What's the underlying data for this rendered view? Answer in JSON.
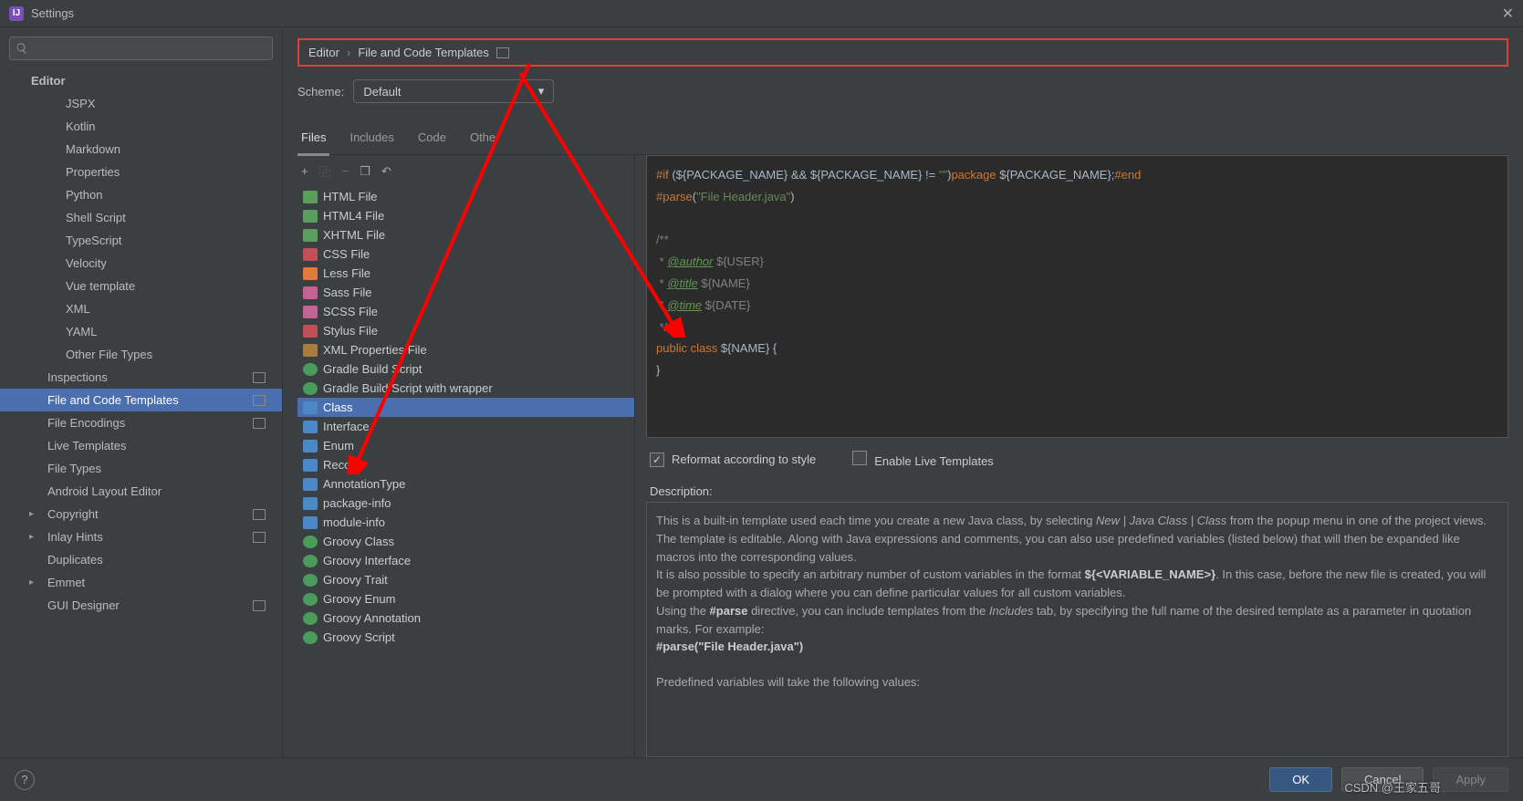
{
  "window": {
    "title": "Settings"
  },
  "sidebar": {
    "items": [
      {
        "label": "Editor",
        "lvl": 1
      },
      {
        "label": "JSPX",
        "lvl": 3
      },
      {
        "label": "Kotlin",
        "lvl": 3
      },
      {
        "label": "Markdown",
        "lvl": 3
      },
      {
        "label": "Properties",
        "lvl": 3
      },
      {
        "label": "Python",
        "lvl": 3
      },
      {
        "label": "Shell Script",
        "lvl": 3
      },
      {
        "label": "TypeScript",
        "lvl": 3
      },
      {
        "label": "Velocity",
        "lvl": 3
      },
      {
        "label": "Vue template",
        "lvl": 3
      },
      {
        "label": "XML",
        "lvl": 3
      },
      {
        "label": "YAML",
        "lvl": 3
      },
      {
        "label": "Other File Types",
        "lvl": 3
      },
      {
        "label": "Inspections",
        "lvl": 2,
        "badge": true
      },
      {
        "label": "File and Code Templates",
        "lvl": 2,
        "selected": true,
        "badge": true
      },
      {
        "label": "File Encodings",
        "lvl": 2,
        "badge": true
      },
      {
        "label": "Live Templates",
        "lvl": 2
      },
      {
        "label": "File Types",
        "lvl": 2
      },
      {
        "label": "Android Layout Editor",
        "lvl": 2
      },
      {
        "label": "Copyright",
        "lvl": 2,
        "expand": true,
        "badge": true
      },
      {
        "label": "Inlay Hints",
        "lvl": 2,
        "expand": true,
        "badge": true
      },
      {
        "label": "Duplicates",
        "lvl": 2
      },
      {
        "label": "Emmet",
        "lvl": 2,
        "expand": true
      },
      {
        "label": "GUI Designer",
        "lvl": 2,
        "badge": true
      }
    ]
  },
  "breadcrumb": {
    "part1": "Editor",
    "part2": "File and Code Templates"
  },
  "scheme": {
    "label": "Scheme:",
    "value": "Default"
  },
  "tabs": [
    "Files",
    "Includes",
    "Code",
    "Other"
  ],
  "toolbar": {
    "add": "+",
    "copy": "⿻",
    "remove": "−",
    "copy2": "❐",
    "undo": "↶"
  },
  "fileList": [
    {
      "label": "HTML File",
      "ic": "ic-html"
    },
    {
      "label": "HTML4 File",
      "ic": "ic-html"
    },
    {
      "label": "XHTML File",
      "ic": "ic-html"
    },
    {
      "label": "CSS File",
      "ic": "ic-css"
    },
    {
      "label": "Less File",
      "ic": "ic-less"
    },
    {
      "label": "Sass File",
      "ic": "ic-sass"
    },
    {
      "label": "SCSS File",
      "ic": "ic-sass"
    },
    {
      "label": "Stylus File",
      "ic": "ic-css"
    },
    {
      "label": "XML Properties File",
      "ic": "ic-xml"
    },
    {
      "label": "Gradle Build Script",
      "ic": "ic-gradle"
    },
    {
      "label": "Gradle Build Script with wrapper",
      "ic": "ic-gradle"
    },
    {
      "label": "Class",
      "ic": "ic-java",
      "selected": true
    },
    {
      "label": "Interface",
      "ic": "ic-java"
    },
    {
      "label": "Enum",
      "ic": "ic-java"
    },
    {
      "label": "Record",
      "ic": "ic-java"
    },
    {
      "label": "AnnotationType",
      "ic": "ic-java"
    },
    {
      "label": "package-info",
      "ic": "ic-java"
    },
    {
      "label": "module-info",
      "ic": "ic-java"
    },
    {
      "label": "Groovy Class",
      "ic": "ic-groovy"
    },
    {
      "label": "Groovy Interface",
      "ic": "ic-groovy"
    },
    {
      "label": "Groovy Trait",
      "ic": "ic-groovy"
    },
    {
      "label": "Groovy Enum",
      "ic": "ic-groovy"
    },
    {
      "label": "Groovy Annotation",
      "ic": "ic-groovy"
    },
    {
      "label": "Groovy Script",
      "ic": "ic-groovy"
    }
  ],
  "editor": {
    "l1a": "#if",
    "l1b": " (${PACKAGE_NAME} && ${PACKAGE_NAME} != ",
    "l1c": "\"\"",
    "l1d": ")",
    "l1e": "package",
    "l1f": " ${PACKAGE_NAME};",
    "l1g": "#end",
    "l2a": "#parse",
    "l2b": "(",
    "l2c": "\"File Header.java\"",
    "l2d": ")",
    "l4": "/**",
    "l5a": " * ",
    "l5b": "@author",
    "l5c": " ${USER}",
    "l6a": " * ",
    "l6b": "@title",
    "l6c": " ${NAME}",
    "l7a": " * ",
    "l7b": "@time",
    "l7c": " ${DATE}",
    "l8": " */",
    "l9a": "public",
    "l9b": " ",
    "l9c": "class",
    "l9d": " ${NAME} {",
    "l10": "}"
  },
  "checks": {
    "reformat": "Reformat according to style",
    "live": "Enable Live Templates"
  },
  "descLabel": "Description:",
  "desc": {
    "p1a": "This is a built-in template used each time you create a new Java class, by selecting ",
    "p1b": "New | Java Class | Class",
    "p1c": " from the popup menu in one of the project views.",
    "p2": "The template is editable. Along with Java expressions and comments, you can also use predefined variables (listed below) that will then be expanded like macros into the corresponding values.",
    "p3a": "It is also possible to specify an arbitrary number of custom variables in the format ",
    "p3b": "${<VARIABLE_NAME>}",
    "p3c": ". In this case, before the new file is created, you will be prompted with a dialog where you can define particular values for all custom variables.",
    "p4a": "Using the ",
    "p4b": "#parse",
    "p4c": " directive, you can include templates from the ",
    "p4d": "Includes",
    "p4e": " tab, by specifying the full name of the desired template as a parameter in quotation marks. For example:",
    "p5": "#parse(\"File Header.java\")",
    "p6": "Predefined variables will take the following values:"
  },
  "buttons": {
    "ok": "OK",
    "cancel": "Cancel",
    "apply": "Apply"
  },
  "watermark": "CSDN @王家五哥"
}
